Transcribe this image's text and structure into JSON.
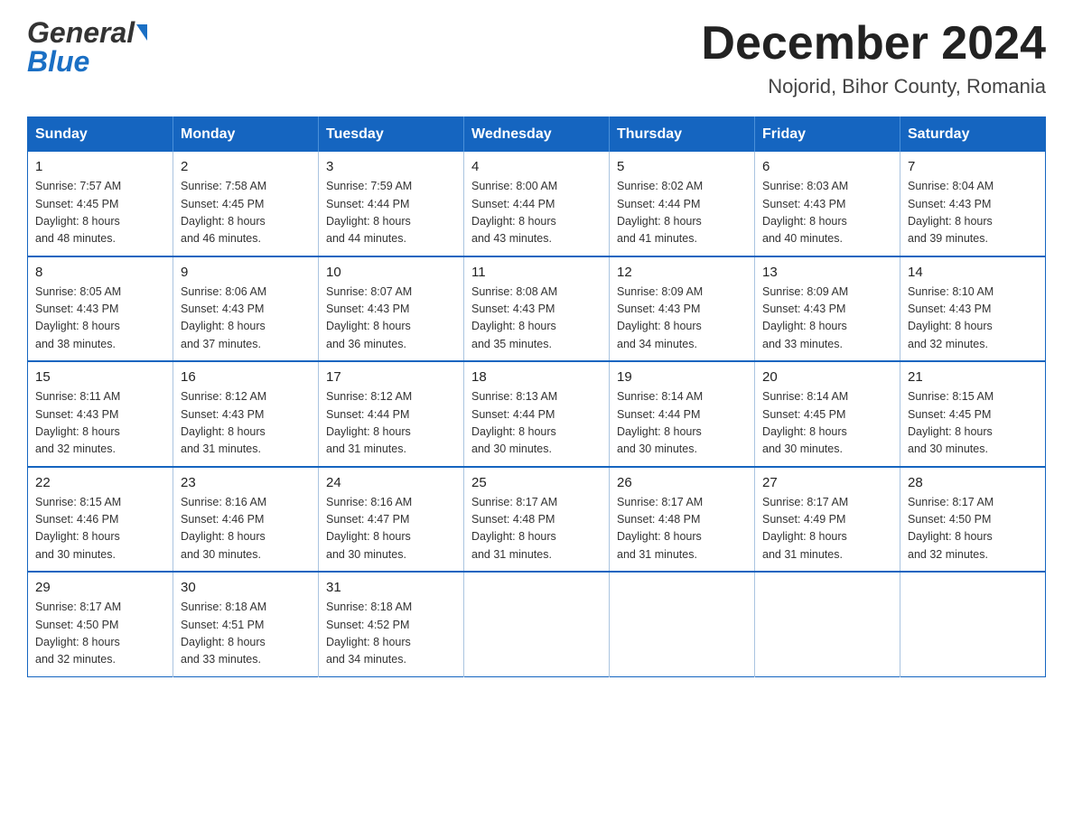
{
  "logo": {
    "general": "General",
    "blue": "Blue",
    "line2": "Blue"
  },
  "header": {
    "title": "December 2024",
    "subtitle": "Nojorid, Bihor County, Romania"
  },
  "calendar": {
    "days": [
      "Sunday",
      "Monday",
      "Tuesday",
      "Wednesday",
      "Thursday",
      "Friday",
      "Saturday"
    ],
    "weeks": [
      [
        {
          "day": "1",
          "sunrise": "7:57 AM",
          "sunset": "4:45 PM",
          "daylight": "8 hours and 48 minutes."
        },
        {
          "day": "2",
          "sunrise": "7:58 AM",
          "sunset": "4:45 PM",
          "daylight": "8 hours and 46 minutes."
        },
        {
          "day": "3",
          "sunrise": "7:59 AM",
          "sunset": "4:44 PM",
          "daylight": "8 hours and 44 minutes."
        },
        {
          "day": "4",
          "sunrise": "8:00 AM",
          "sunset": "4:44 PM",
          "daylight": "8 hours and 43 minutes."
        },
        {
          "day": "5",
          "sunrise": "8:02 AM",
          "sunset": "4:44 PM",
          "daylight": "8 hours and 41 minutes."
        },
        {
          "day": "6",
          "sunrise": "8:03 AM",
          "sunset": "4:43 PM",
          "daylight": "8 hours and 40 minutes."
        },
        {
          "day": "7",
          "sunrise": "8:04 AM",
          "sunset": "4:43 PM",
          "daylight": "8 hours and 39 minutes."
        }
      ],
      [
        {
          "day": "8",
          "sunrise": "8:05 AM",
          "sunset": "4:43 PM",
          "daylight": "8 hours and 38 minutes."
        },
        {
          "day": "9",
          "sunrise": "8:06 AM",
          "sunset": "4:43 PM",
          "daylight": "8 hours and 37 minutes."
        },
        {
          "day": "10",
          "sunrise": "8:07 AM",
          "sunset": "4:43 PM",
          "daylight": "8 hours and 36 minutes."
        },
        {
          "day": "11",
          "sunrise": "8:08 AM",
          "sunset": "4:43 PM",
          "daylight": "8 hours and 35 minutes."
        },
        {
          "day": "12",
          "sunrise": "8:09 AM",
          "sunset": "4:43 PM",
          "daylight": "8 hours and 34 minutes."
        },
        {
          "day": "13",
          "sunrise": "8:09 AM",
          "sunset": "4:43 PM",
          "daylight": "8 hours and 33 minutes."
        },
        {
          "day": "14",
          "sunrise": "8:10 AM",
          "sunset": "4:43 PM",
          "daylight": "8 hours and 32 minutes."
        }
      ],
      [
        {
          "day": "15",
          "sunrise": "8:11 AM",
          "sunset": "4:43 PM",
          "daylight": "8 hours and 32 minutes."
        },
        {
          "day": "16",
          "sunrise": "8:12 AM",
          "sunset": "4:43 PM",
          "daylight": "8 hours and 31 minutes."
        },
        {
          "day": "17",
          "sunrise": "8:12 AM",
          "sunset": "4:44 PM",
          "daylight": "8 hours and 31 minutes."
        },
        {
          "day": "18",
          "sunrise": "8:13 AM",
          "sunset": "4:44 PM",
          "daylight": "8 hours and 30 minutes."
        },
        {
          "day": "19",
          "sunrise": "8:14 AM",
          "sunset": "4:44 PM",
          "daylight": "8 hours and 30 minutes."
        },
        {
          "day": "20",
          "sunrise": "8:14 AM",
          "sunset": "4:45 PM",
          "daylight": "8 hours and 30 minutes."
        },
        {
          "day": "21",
          "sunrise": "8:15 AM",
          "sunset": "4:45 PM",
          "daylight": "8 hours and 30 minutes."
        }
      ],
      [
        {
          "day": "22",
          "sunrise": "8:15 AM",
          "sunset": "4:46 PM",
          "daylight": "8 hours and 30 minutes."
        },
        {
          "day": "23",
          "sunrise": "8:16 AM",
          "sunset": "4:46 PM",
          "daylight": "8 hours and 30 minutes."
        },
        {
          "day": "24",
          "sunrise": "8:16 AM",
          "sunset": "4:47 PM",
          "daylight": "8 hours and 30 minutes."
        },
        {
          "day": "25",
          "sunrise": "8:17 AM",
          "sunset": "4:48 PM",
          "daylight": "8 hours and 31 minutes."
        },
        {
          "day": "26",
          "sunrise": "8:17 AM",
          "sunset": "4:48 PM",
          "daylight": "8 hours and 31 minutes."
        },
        {
          "day": "27",
          "sunrise": "8:17 AM",
          "sunset": "4:49 PM",
          "daylight": "8 hours and 31 minutes."
        },
        {
          "day": "28",
          "sunrise": "8:17 AM",
          "sunset": "4:50 PM",
          "daylight": "8 hours and 32 minutes."
        }
      ],
      [
        {
          "day": "29",
          "sunrise": "8:17 AM",
          "sunset": "4:50 PM",
          "daylight": "8 hours and 32 minutes."
        },
        {
          "day": "30",
          "sunrise": "8:18 AM",
          "sunset": "4:51 PM",
          "daylight": "8 hours and 33 minutes."
        },
        {
          "day": "31",
          "sunrise": "8:18 AM",
          "sunset": "4:52 PM",
          "daylight": "8 hours and 34 minutes."
        },
        null,
        null,
        null,
        null
      ]
    ],
    "labels": {
      "sunrise": "Sunrise: ",
      "sunset": "Sunset: ",
      "daylight": "Daylight: "
    }
  }
}
